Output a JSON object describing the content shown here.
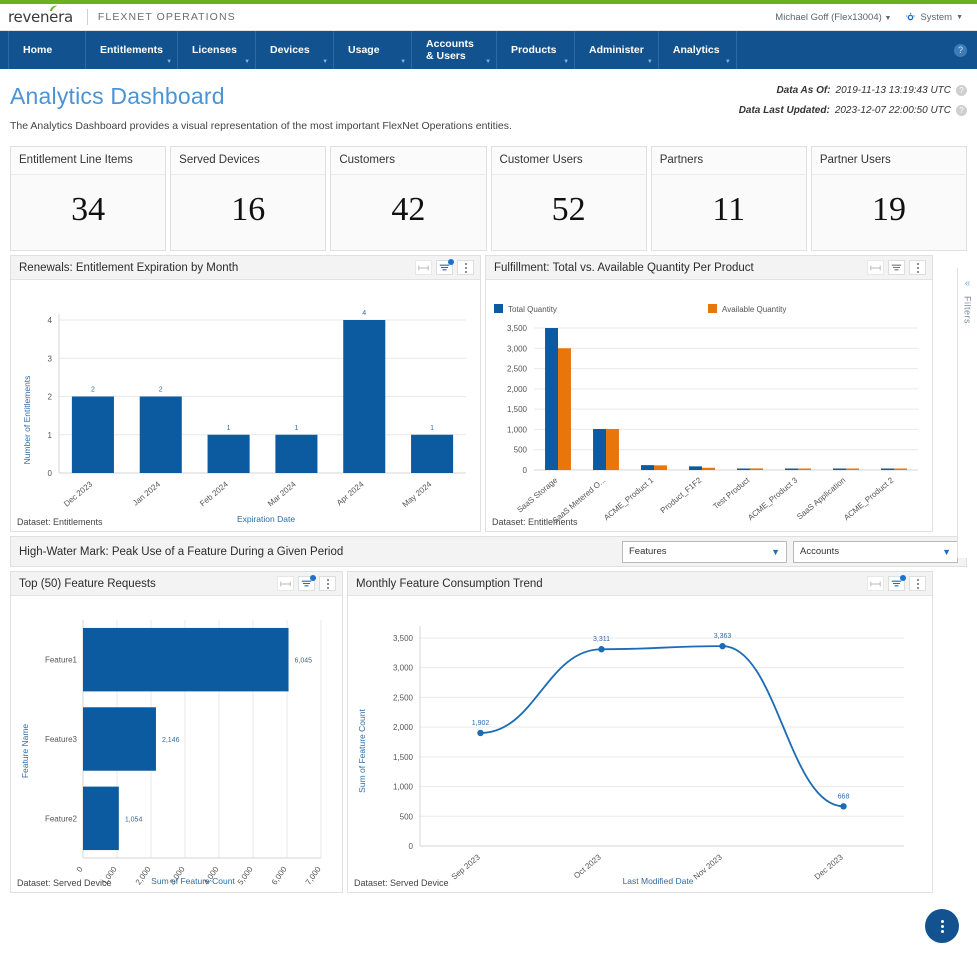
{
  "brand": {
    "logo": "revenera",
    "product": "FLEXNET OPERATIONS",
    "user": "Michael Goff (Flex13004)",
    "system": "System",
    "help_icon": "?"
  },
  "nav": {
    "items": [
      {
        "label": "Home",
        "has_caret": false
      },
      {
        "label": "Entitlements",
        "has_caret": true
      },
      {
        "label": "Licenses",
        "has_caret": true
      },
      {
        "label": "Devices",
        "has_caret": true
      },
      {
        "label": "Usage",
        "has_caret": true
      },
      {
        "label": "Accounts & Users",
        "has_caret": true
      },
      {
        "label": "Products",
        "has_caret": true
      },
      {
        "label": "Administer",
        "has_caret": true
      },
      {
        "label": "Analytics",
        "has_caret": true
      }
    ]
  },
  "page": {
    "title": "Analytics Dashboard",
    "description": "The Analytics Dashboard provides a visual representation of the most important FlexNet Operations entities.",
    "data_as_of_label": "Data As Of:",
    "data_as_of_value": "2019-11-13 13:19:43 UTC",
    "data_last_updated_label": "Data Last Updated:",
    "data_last_updated_value": "2023-12-07 22:00:50 UTC"
  },
  "kpis": [
    {
      "title": "Entitlement Line Items",
      "value": "34"
    },
    {
      "title": "Served Devices",
      "value": "16"
    },
    {
      "title": "Customers",
      "value": "42"
    },
    {
      "title": "Customer Users",
      "value": "52"
    },
    {
      "title": "Partners",
      "value": "11"
    },
    {
      "title": "Partner Users",
      "value": "19"
    }
  ],
  "filters_rail": {
    "label": "Filters",
    "collapse_icon": "«"
  },
  "hwm": {
    "title": "High-Water Mark: Peak Use of a Feature During a Given Period",
    "feature_select": "Features",
    "account_select": "Accounts"
  },
  "cards": {
    "renewals": {
      "title": "Renewals: Entitlement Expiration by Month",
      "dataset": "Dataset: Entitlements",
      "tools": [
        "resize-icon",
        "filter-icon",
        "menu-icon"
      ]
    },
    "fulfillment": {
      "title": "Fulfillment: Total vs. Available Quantity Per Product",
      "dataset": "Dataset: Entitlements",
      "tools": [
        "resize-icon",
        "filter-icon",
        "menu-icon"
      ]
    },
    "feature_requests": {
      "title": "Top (50) Feature Requests",
      "dataset": "Dataset: Served Device",
      "tools": [
        "resize-icon",
        "filter-icon",
        "menu-icon"
      ]
    },
    "consumption": {
      "title": "Monthly Feature Consumption Trend",
      "dataset": "Dataset: Served Device",
      "tools": [
        "resize-icon",
        "filter-icon",
        "menu-icon"
      ]
    }
  },
  "chart_data": [
    {
      "id": "renewals",
      "type": "bar",
      "title": "Renewals: Entitlement Expiration by Month",
      "xlabel": "Expiration Date",
      "ylabel": "Number of Entitlements",
      "categories": [
        "Dec 2023",
        "Jan 2024",
        "Feb 2024",
        "Mar 2024",
        "Apr 2024",
        "May 2024"
      ],
      "values": [
        2,
        2,
        1,
        1,
        4,
        1
      ],
      "value_labels": [
        "2",
        "2",
        "1",
        "1",
        "4",
        "1"
      ],
      "yticks": [
        0,
        1,
        2,
        3,
        4
      ],
      "ytick_labels": [
        "0",
        "1",
        "2",
        "3",
        "4"
      ],
      "ylim": [
        0,
        4
      ],
      "grid": true,
      "legend": "none",
      "series_color": "#0c5ba0"
    },
    {
      "id": "fulfillment",
      "type": "bar",
      "title": "Fulfillment: Total vs. Available Quantity Per Product",
      "xlabel": "",
      "ylabel": "",
      "categories": [
        "SaaS Storage",
        "SaaS Metered O...",
        "ACME_Product 1",
        "Product_F1F2",
        "Test Product",
        "ACME_Product 3",
        "SaaS Application",
        "ACME_Product 2"
      ],
      "series": [
        {
          "name": "Total Quantity",
          "color": "#0c5ba0",
          "values": [
            3500,
            1010,
            120,
            90,
            20,
            20,
            20,
            10
          ]
        },
        {
          "name": "Available Quantity",
          "color": "#e8760b",
          "values": [
            3000,
            1010,
            115,
            55,
            40,
            15,
            12,
            8
          ]
        }
      ],
      "yticks": [
        0,
        500,
        1000,
        1500,
        2000,
        2500,
        3000,
        3500
      ],
      "ytick_labels": [
        "0",
        "500",
        "1,000",
        "1,500",
        "2,000",
        "2,500",
        "3,000",
        "3,500"
      ],
      "ylim": [
        0,
        3500
      ],
      "grid": true,
      "legend": "top"
    },
    {
      "id": "feature_requests",
      "type": "bar",
      "orientation": "horizontal",
      "title": "Top (50) Feature Requests",
      "xlabel": "Sum of Feature Count",
      "ylabel": "Feature Name",
      "categories": [
        "Feature1",
        "Feature3",
        "Feature2"
      ],
      "values": [
        6045,
        2146,
        1054
      ],
      "value_labels": [
        "6,045",
        "2,146",
        "1,054"
      ],
      "xticks": [
        0,
        1000,
        2000,
        3000,
        4000,
        5000,
        6000,
        7000
      ],
      "xtick_labels": [
        "0",
        "1,000",
        "2,000",
        "3,000",
        "4,000",
        "5,000",
        "6,000",
        "7,000"
      ],
      "xlim": [
        0,
        7000
      ],
      "grid": true,
      "legend": "none",
      "series_color": "#0c5ba0"
    },
    {
      "id": "consumption",
      "type": "line",
      "title": "Monthly Feature Consumption Trend",
      "xlabel": "Last Modified Date",
      "ylabel": "Sum of Feature Count",
      "categories": [
        "Sep 2023",
        "Oct 2023",
        "Nov 2023",
        "Dec 2023"
      ],
      "values": [
        1902,
        3311,
        3363,
        668
      ],
      "value_labels": [
        "1,902",
        "3,311",
        "3,363",
        "668"
      ],
      "yticks": [
        0,
        500,
        1000,
        1500,
        2000,
        2500,
        3000,
        3500
      ],
      "ytick_labels": [
        "0",
        "500",
        "1,000",
        "1,500",
        "2,000",
        "2,500",
        "3,000",
        "3,500"
      ],
      "ylim": [
        0,
        3500
      ],
      "grid": true,
      "legend": "none",
      "series_color": "#1c6bb5"
    }
  ],
  "fab": {
    "icon": "menu-icon"
  }
}
